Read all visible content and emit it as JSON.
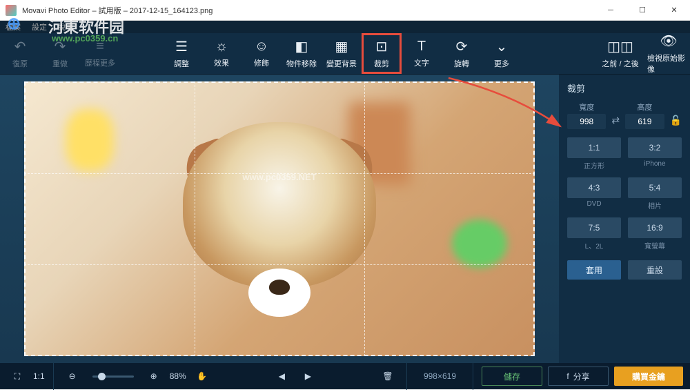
{
  "titlebar": {
    "title": "Movavi Photo Editor – 試用版 – 2017-12-15_164123.png"
  },
  "watermark": {
    "logo": "⊕",
    "text": "河東软件园",
    "url": "www.pc0359.cn"
  },
  "menubar": {
    "file": "檔案",
    "settings": "設定",
    "help": "說明"
  },
  "toolbar": {
    "undo": "復原",
    "redo": "重做",
    "history": "歷程更多",
    "adjust": "調整",
    "effects": "效果",
    "retouch": "修飾",
    "objectRemove": "物件移除",
    "bgChange": "變更背景",
    "crop": "裁剪",
    "text": "文字",
    "rotate": "旋轉",
    "more": "更多",
    "beforeAfter": "之前 / 之後",
    "viewOriginal": "檢視原始影像"
  },
  "cropPanel": {
    "title": "裁剪",
    "widthLabel": "寬度",
    "heightLabel": "高度",
    "width": "998",
    "height": "619",
    "ratios": [
      {
        "value": "1:1",
        "label": "正方形"
      },
      {
        "value": "3:2",
        "label": "iPhone"
      },
      {
        "value": "4:3",
        "label": "DVD"
      },
      {
        "value": "5:4",
        "label": "相片"
      },
      {
        "value": "7:5",
        "label": "L、2L"
      },
      {
        "value": "16:9",
        "label": "寬螢幕"
      }
    ],
    "apply": "套用",
    "reset": "重設"
  },
  "imageWatermark": "www.pc0359.NET",
  "statusbar": {
    "fitLabel": "1:1",
    "zoom": "88%",
    "dimensions": "998×619",
    "save": "儲存",
    "share": "分享",
    "buy": "購買金鑰"
  }
}
